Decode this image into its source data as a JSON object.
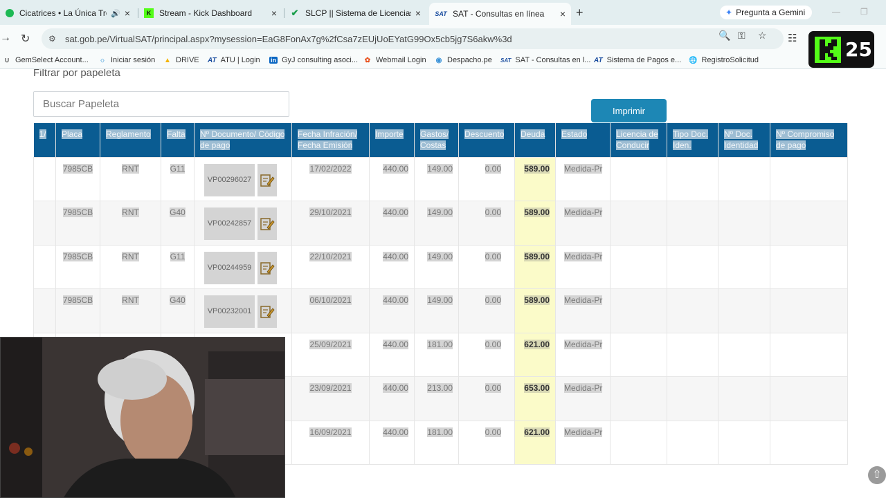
{
  "browser": {
    "tabs": [
      {
        "title": "Cicatrices • La Única Tropical",
        "active": false
      },
      {
        "title": "Stream - Kick Dashboard",
        "active": false
      },
      {
        "title": "SLCP || Sistema de Licencias de",
        "active": false
      },
      {
        "title": "SAT - Consultas en línea",
        "active": true
      }
    ],
    "gemini_label": "Pregunta a Gemini",
    "url": "sat.gob.pe/VirtualSAT/principal.aspx?mysession=EaG8FonAx7g%2fCsa7zEUjUoEYatG99Ox5cb5jg7S6akw%3d",
    "bookmarks": [
      "GemSelect Account...",
      "Iniciar sesión",
      "DRIVE",
      "ATU | Login",
      "GyJ consulting asoci...",
      "Webmail Login",
      "Despacho.pe",
      "SAT - Consultas en l...",
      "Sistema de Pagos e...",
      "RegistroSolicitud"
    ]
  },
  "overlay": {
    "kick_count": "25"
  },
  "page": {
    "filter_label": "Filtrar por papeleta",
    "search_placeholder": "Buscar Papeleta",
    "print_label": "Imprimir"
  },
  "table": {
    "headers": [
      "1/",
      "Placa",
      "Reglamento",
      "Falta",
      "Nº Documento/ Código de pago",
      "Fecha Infración/ Fecha Emisión",
      "Importe",
      "Gastos/ Costas",
      "Descuento",
      "Deuda",
      "Estado",
      "Licencia de Conducir",
      "Tipo Doc. Iden.",
      "Nº Doc. Identidad",
      "Nº Compromiso de pago"
    ],
    "rows": [
      {
        "placa": "7985CB",
        "reglamento": "RNT",
        "falta": "G11",
        "documento": "VP00296027",
        "fecha": "17/02/2022",
        "importe": "440.00",
        "gastos": "149.00",
        "descuento": "0.00",
        "deuda": "589.00",
        "estado": "Medida-Pr"
      },
      {
        "placa": "7985CB",
        "reglamento": "RNT",
        "falta": "G40",
        "documento": "VP00242857",
        "fecha": "29/10/2021",
        "importe": "440.00",
        "gastos": "149.00",
        "descuento": "0.00",
        "deuda": "589.00",
        "estado": "Medida-Pr"
      },
      {
        "placa": "7985CB",
        "reglamento": "RNT",
        "falta": "G11",
        "documento": "VP00244959",
        "fecha": "22/10/2021",
        "importe": "440.00",
        "gastos": "149.00",
        "descuento": "0.00",
        "deuda": "589.00",
        "estado": "Medida-Pr"
      },
      {
        "placa": "7985CB",
        "reglamento": "RNT",
        "falta": "G40",
        "documento": "VP00232001",
        "fecha": "06/10/2021",
        "importe": "440.00",
        "gastos": "149.00",
        "descuento": "0.00",
        "deuda": "589.00",
        "estado": "Medida-Pr"
      },
      {
        "placa": "",
        "reglamento": "",
        "falta": "",
        "documento": "",
        "fecha": "25/09/2021",
        "importe": "440.00",
        "gastos": "181.00",
        "descuento": "0.00",
        "deuda": "621.00",
        "estado": "Medida-Pr"
      },
      {
        "placa": "",
        "reglamento": "",
        "falta": "",
        "documento": "",
        "fecha": "23/09/2021",
        "importe": "440.00",
        "gastos": "213.00",
        "descuento": "0.00",
        "deuda": "653.00",
        "estado": "Medida-Pr"
      },
      {
        "placa": "",
        "reglamento": "",
        "falta": "",
        "documento": "",
        "fecha": "16/09/2021",
        "importe": "440.00",
        "gastos": "181.00",
        "descuento": "0.00",
        "deuda": "621.00",
        "estado": "Medida-Pr"
      }
    ]
  },
  "colors": {
    "header_bg": "#0a5c92",
    "print_button": "#1d87b5",
    "deuda_highlight": "#fbfbc9",
    "kick_green": "#53fc18"
  }
}
